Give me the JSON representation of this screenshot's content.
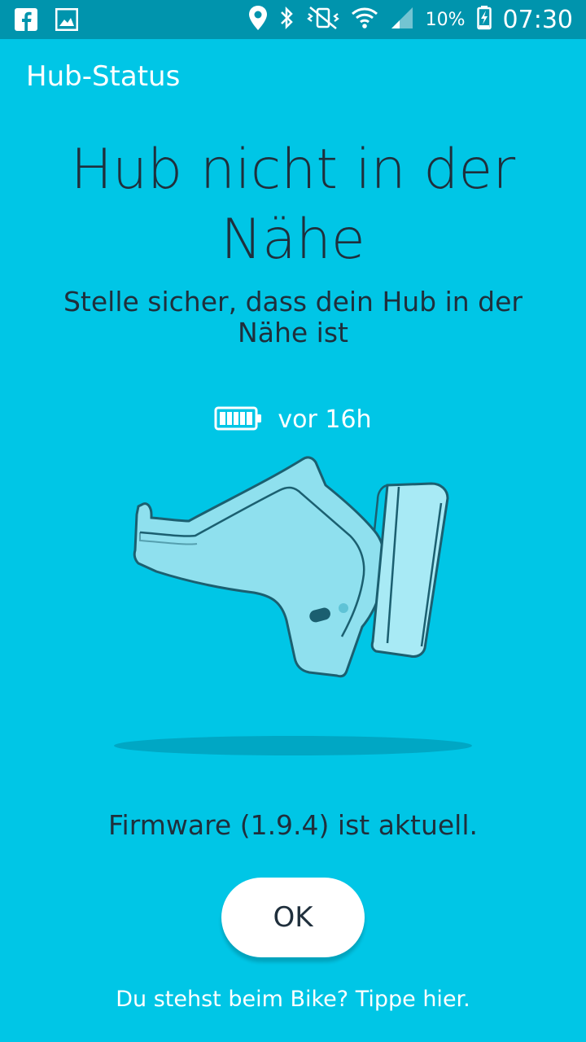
{
  "status_bar": {
    "battery_percent": "10%",
    "time": "07:30",
    "icons": [
      "facebook-icon",
      "gallery-icon",
      "location-icon",
      "bluetooth-icon",
      "vibrate-icon",
      "wifi-icon",
      "signal-icon",
      "battery-charging-icon"
    ]
  },
  "app_bar": {
    "title": "Hub-Status"
  },
  "main": {
    "headline": "Hub nicht in der Nähe",
    "subline": "Stelle sicher, dass dein Hub in der Nähe ist",
    "battery": {
      "label": "vor 16h",
      "level": 1.0
    },
    "firmware": "Firmware (1.9.4) ist aktuell.",
    "ok_label": "OK",
    "bike_link": "Du stehst beim Bike? Tippe hier."
  },
  "colors": {
    "background": "#00c6e6",
    "status_bar": "#0094ad",
    "text_dark": "#1f2f3c",
    "hub_body": "#8fe0ee",
    "hub_outline": "#1b5f70"
  }
}
